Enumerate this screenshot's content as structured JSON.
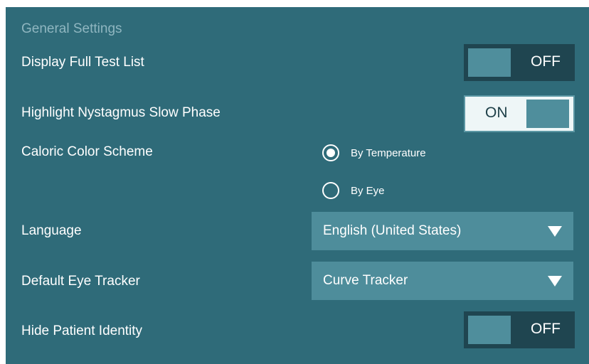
{
  "section": {
    "title": "General Settings"
  },
  "settings": {
    "display_full_test_list": {
      "label": "Display Full Test List",
      "state": "OFF"
    },
    "highlight_nystagmus": {
      "label": "Highlight Nystagmus Slow Phase",
      "state": "ON"
    },
    "caloric_color_scheme": {
      "label": "Caloric Color Scheme",
      "options": [
        "By Temperature",
        "By Eye"
      ],
      "selected": "By Temperature"
    },
    "language": {
      "label": "Language",
      "value": "English (United States)"
    },
    "default_eye_tracker": {
      "label": "Default Eye Tracker",
      "value": "Curve Tracker"
    },
    "hide_patient_identity": {
      "label": "Hide Patient Identity",
      "state": "OFF"
    }
  },
  "colors": {
    "panel": "#2f6b79",
    "toggle_off_bg": "#1f4550",
    "toggle_on_bg": "#eef6f7",
    "dropdown_bg": "#4e8d9b",
    "section_title": "#8fb6c0"
  },
  "icons": [
    "radio-selected-icon",
    "radio-unselected-icon",
    "dropdown-caret-icon"
  ]
}
